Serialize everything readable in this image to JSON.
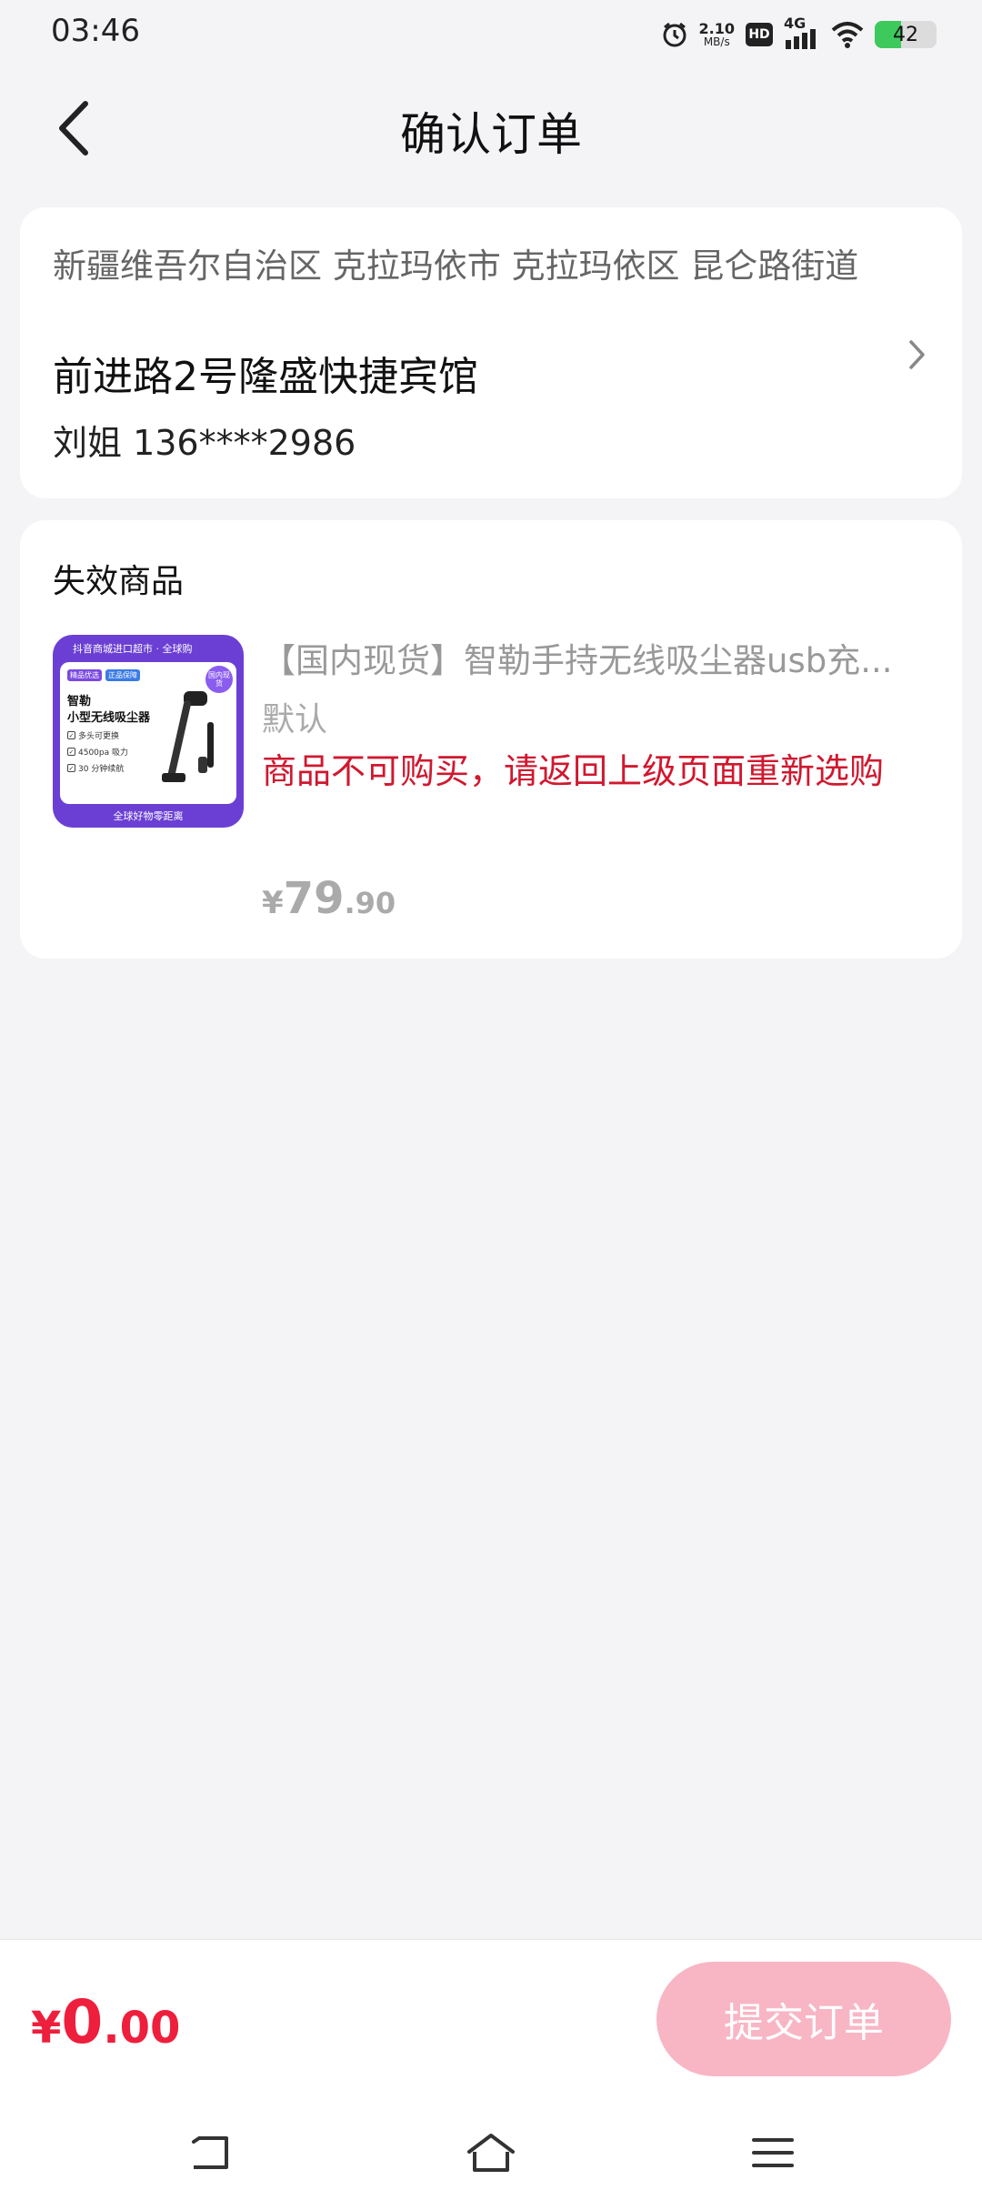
{
  "status_bar": {
    "time": "03:46",
    "speed_value": "2.10",
    "speed_unit": "MB/s",
    "hd": "HD",
    "network": "4G",
    "battery": "42",
    "battery_level": 0.42,
    "icons": [
      "alarm-icon",
      "hd-icon",
      "signal-icon",
      "wifi-icon",
      "battery-icon"
    ]
  },
  "header": {
    "title": "确认订单",
    "back_icon": "back-arrow-icon"
  },
  "address": {
    "region": "新疆维吾尔自治区 克拉玛依市 克拉玛依区 昆仑路街道",
    "detail": "前进路2号隆盛快捷宾馆",
    "contact": "刘姐 136****2986"
  },
  "product_section": {
    "title": "失效商品",
    "product": {
      "name": "【国内现货】智勒手持无线吸尘器usb充...",
      "spec": "默认",
      "error": "商品不可购买，请返回上级页面重新选购",
      "price_symbol": "¥",
      "price_int": "79",
      "price_dec": ".90",
      "thumbnail": {
        "top_text": "抖音商城进口超市 · 全球购",
        "tag1": "精品优选",
        "tag2": "正品保障",
        "badge": "国内现货",
        "name_line1": "智勒",
        "name_line2": "小型无线吸尘器",
        "features": [
          "多头可更换",
          "4500pa 吸力",
          "30 分钟续航"
        ],
        "bottom_text": "全球好物零距离"
      }
    }
  },
  "footer": {
    "total_symbol": "¥",
    "total_int": "0",
    "total_dec": ".00",
    "submit_label": "提交订单"
  },
  "nav": {
    "icons": [
      "back-nav-icon",
      "home-icon",
      "menu-icon"
    ]
  },
  "colors": {
    "accent": "#ee1f3c",
    "error": "#d0182f",
    "submit_disabled": "#f8b6c4",
    "background": "#f4f4f6"
  }
}
